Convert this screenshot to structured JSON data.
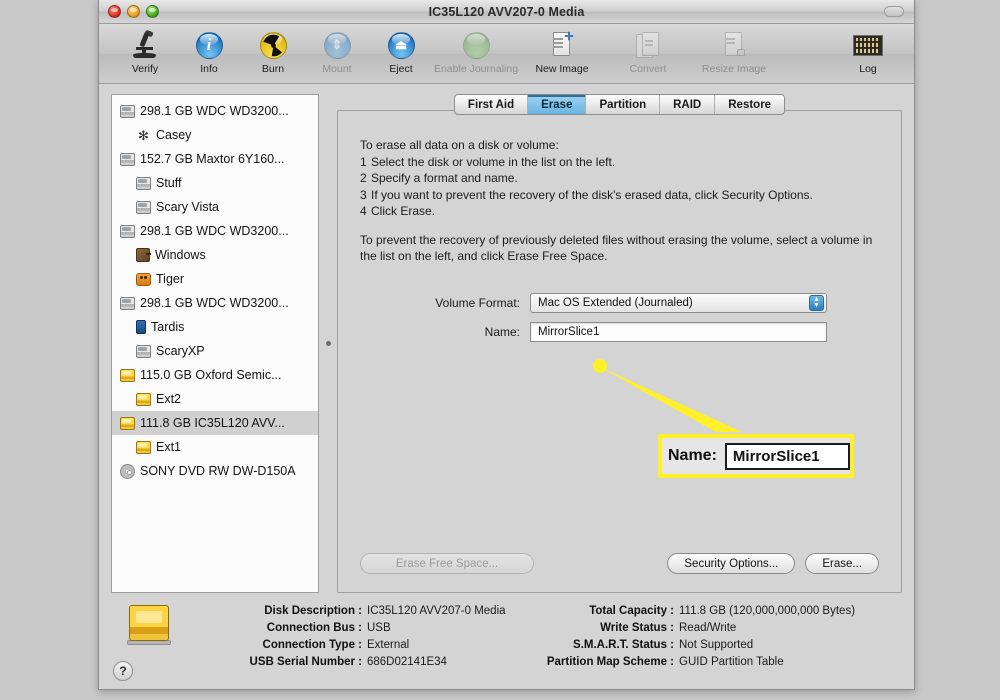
{
  "window": {
    "title": "IC35L120 AVV207-0 Media"
  },
  "toolbar": {
    "items": [
      {
        "label": "Verify",
        "icon": "microscope-icon",
        "enabled": true
      },
      {
        "label": "Info",
        "icon": "info-icon",
        "enabled": true
      },
      {
        "label": "Burn",
        "icon": "radiation-burn-icon",
        "enabled": true
      },
      {
        "label": "Mount",
        "icon": "mount-icon",
        "enabled": false
      },
      {
        "label": "Eject",
        "icon": "eject-icon",
        "enabled": true
      },
      {
        "label": "Enable Journaling",
        "icon": "journaling-icon",
        "enabled": false
      },
      {
        "label": "New Image",
        "icon": "new-image-icon",
        "enabled": true
      },
      {
        "label": "Convert",
        "icon": "convert-icon",
        "enabled": false
      },
      {
        "label": "Resize Image",
        "icon": "resize-image-icon",
        "enabled": false
      }
    ],
    "log": {
      "label": "Log",
      "icon": "log-icon"
    }
  },
  "sidebar": {
    "items": [
      {
        "label": "298.1 GB WDC WD3200...",
        "type": "disk",
        "icon": "hard-drive-icon",
        "selected": false
      },
      {
        "label": "Casey",
        "type": "volume",
        "icon": "gear-volume-icon",
        "selected": false
      },
      {
        "label": "152.7 GB Maxtor 6Y160...",
        "type": "disk",
        "icon": "hard-drive-icon",
        "selected": false
      },
      {
        "label": "Stuff",
        "type": "volume",
        "icon": "hard-drive-icon",
        "selected": false
      },
      {
        "label": "Scary Vista",
        "type": "volume",
        "icon": "hard-drive-icon",
        "selected": false
      },
      {
        "label": "298.1 GB WDC WD3200...",
        "type": "disk",
        "icon": "hard-drive-icon",
        "selected": false
      },
      {
        "label": "Windows",
        "type": "volume",
        "icon": "windows-icon",
        "selected": false
      },
      {
        "label": "Tiger",
        "type": "volume",
        "icon": "tiger-icon",
        "selected": false
      },
      {
        "label": "298.1 GB WDC WD3200...",
        "type": "disk",
        "icon": "hard-drive-icon",
        "selected": false
      },
      {
        "label": "Tardis",
        "type": "volume",
        "icon": "tardis-icon",
        "selected": false
      },
      {
        "label": "ScaryXP",
        "type": "volume",
        "icon": "hard-drive-icon",
        "selected": false
      },
      {
        "label": "115.0 GB Oxford Semic...",
        "type": "disk",
        "icon": "gold-drive-icon",
        "selected": false
      },
      {
        "label": "Ext2",
        "type": "volume",
        "icon": "gold-drive-icon",
        "selected": false
      },
      {
        "label": "111.8 GB IC35L120 AVV...",
        "type": "disk",
        "icon": "gold-drive-icon",
        "selected": true
      },
      {
        "label": "Ext1",
        "type": "volume",
        "icon": "gold-drive-icon",
        "selected": false
      },
      {
        "label": "SONY DVD RW DW-D150A",
        "type": "disk",
        "icon": "optical-disc-icon",
        "selected": false
      }
    ]
  },
  "tabs": [
    {
      "label": "First Aid",
      "active": false
    },
    {
      "label": "Erase",
      "active": true
    },
    {
      "label": "Partition",
      "active": false
    },
    {
      "label": "RAID",
      "active": false
    },
    {
      "label": "Restore",
      "active": false
    }
  ],
  "instructions": {
    "heading": "To erase all data on a disk or volume:",
    "steps": [
      {
        "num": "1",
        "text": "Select the disk or volume in the list on the left."
      },
      {
        "num": "2",
        "text": "Specify a format and name."
      },
      {
        "num": "3",
        "text": "If you want to prevent the recovery of the disk's erased data, click Security Options."
      },
      {
        "num": "4",
        "text": "Click Erase."
      }
    ],
    "note": "To prevent the recovery of previously deleted files without erasing the volume, select a volume in the list on the left, and click Erase Free Space."
  },
  "form": {
    "volume_format_label": "Volume Format:",
    "volume_format_value": "Mac OS Extended (Journaled)",
    "name_label": "Name:",
    "name_value": "MirrorSlice1"
  },
  "buttons": {
    "erase_free_space": "Erase Free Space...",
    "security_options": "Security Options...",
    "erase": "Erase..."
  },
  "callout": {
    "label": "Name:",
    "value": "MirrorSlice1",
    "border_color": "#fff02a"
  },
  "info": {
    "left": [
      {
        "key": "Disk Description :",
        "value": "IC35L120 AVV207-0 Media"
      },
      {
        "key": "Connection Bus :",
        "value": "USB"
      },
      {
        "key": "Connection Type :",
        "value": "External"
      },
      {
        "key": "USB Serial Number :",
        "value": "686D02141E34"
      }
    ],
    "right": [
      {
        "key": "Total Capacity :",
        "value": "111.8 GB (120,000,000,000 Bytes)"
      },
      {
        "key": "Write Status :",
        "value": "Read/Write"
      },
      {
        "key": "S.M.A.R.T. Status :",
        "value": "Not Supported"
      },
      {
        "key": "Partition Map Scheme :",
        "value": "GUID Partition Table"
      }
    ],
    "help_label": "?"
  }
}
